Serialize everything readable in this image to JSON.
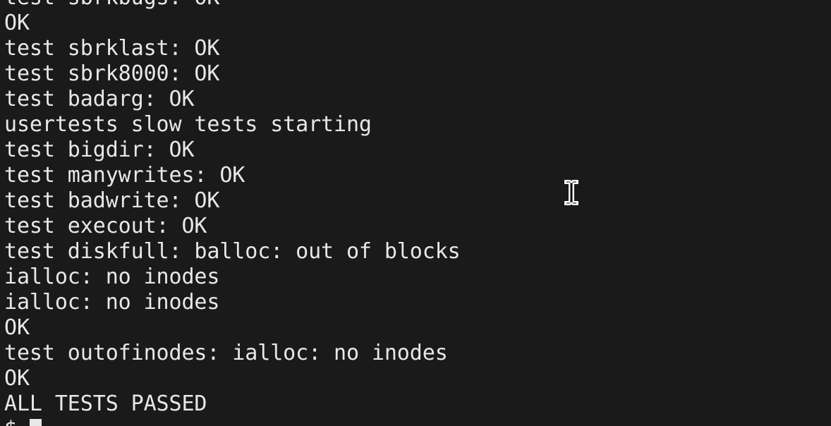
{
  "terminal": {
    "lines": [
      "test sbrkbugs: OK",
      "OK",
      "test sbrklast: OK",
      "test sbrk8000: OK",
      "test badarg: OK",
      "usertests slow tests starting",
      "test bigdir: OK",
      "test manywrites: OK",
      "test badwrite: OK",
      "test execout: OK",
      "test diskfull: balloc: out of blocks",
      "ialloc: no inodes",
      "ialloc: no inodes",
      "OK",
      "test outofinodes: ialloc: no inodes",
      "OK",
      "ALL TESTS PASSED"
    ],
    "prompt": "$ ",
    "colors": {
      "background": "#1a1a1a",
      "text": "#e8e8e8"
    },
    "mouse_cursor_icon": "text-ibeam-icon"
  }
}
